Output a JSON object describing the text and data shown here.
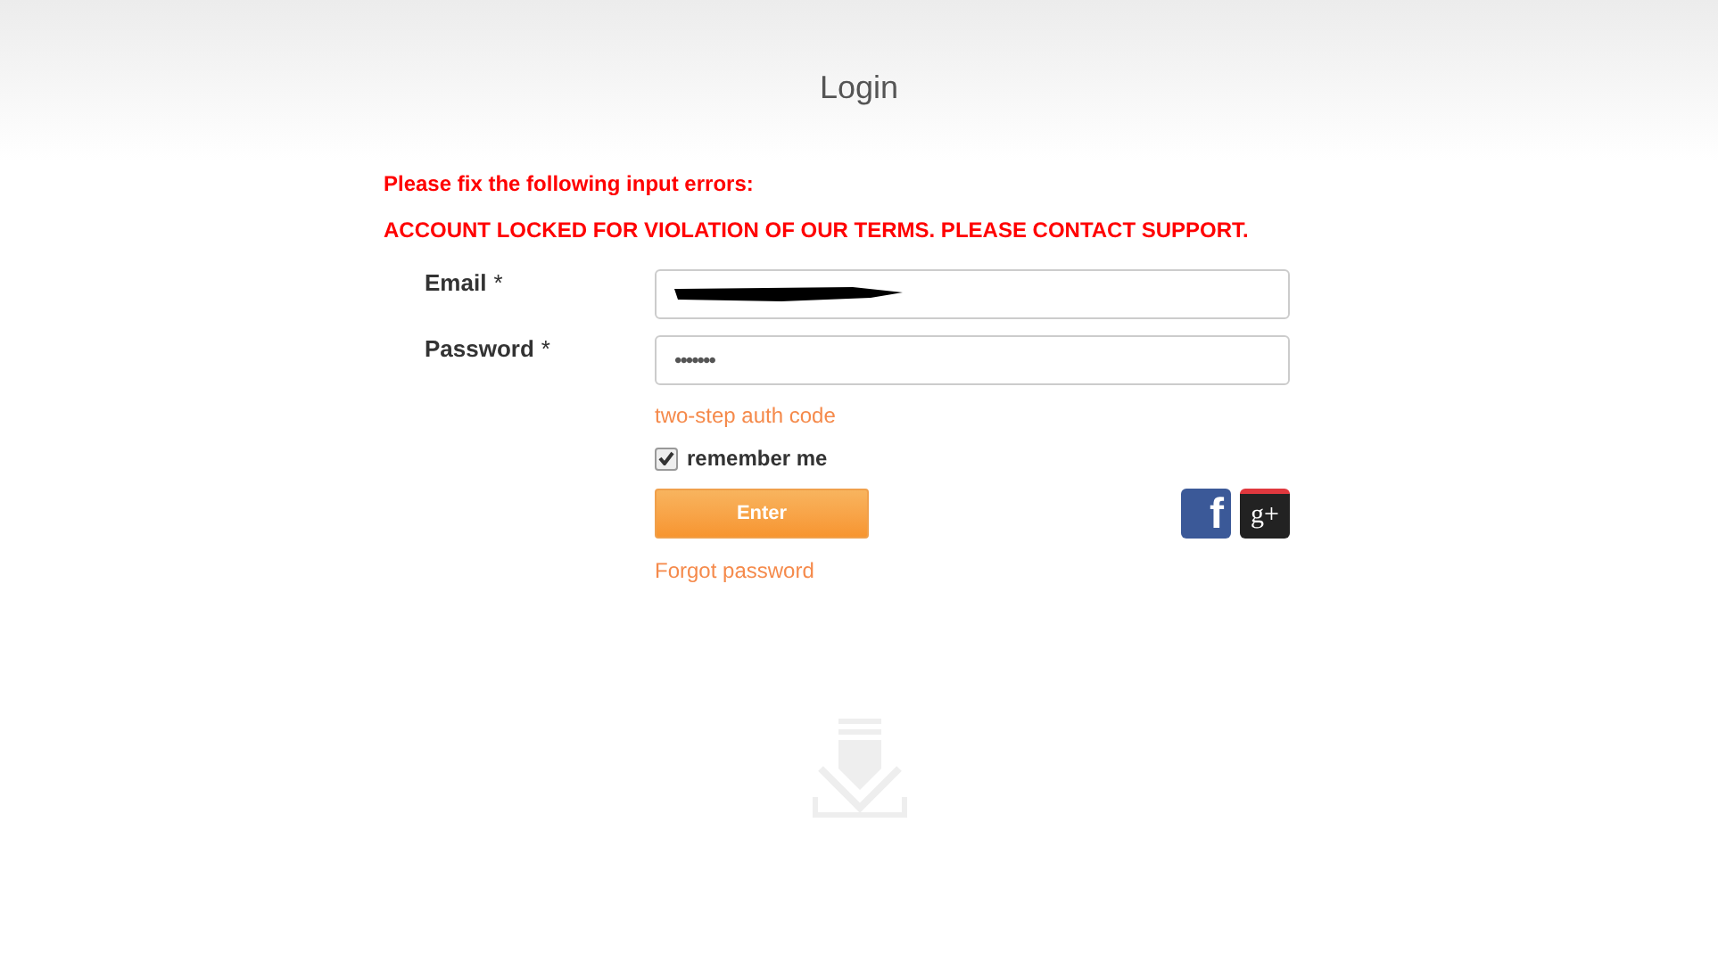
{
  "header": {
    "title": "Login"
  },
  "errors": {
    "heading": "Please fix the following input errors:",
    "message": "ACCOUNT LOCKED FOR VIOLATION OF OUR TERMS. PLEASE CONTACT SUPPORT."
  },
  "fields": [
    {
      "label": "Email",
      "required_mark": "*",
      "kind": "redacted"
    },
    {
      "label": "Password",
      "required_mark": "*",
      "kind": "password",
      "value": "•••••••"
    }
  ],
  "two_step_link": "two-step auth code",
  "remember": {
    "label": "remember me",
    "checked": true
  },
  "enter_button": "Enter",
  "social": [
    {
      "kind": "facebook",
      "glyph": "f"
    },
    {
      "kind": "google",
      "glyph": "g+"
    }
  ],
  "forgot_link": "Forgot password"
}
